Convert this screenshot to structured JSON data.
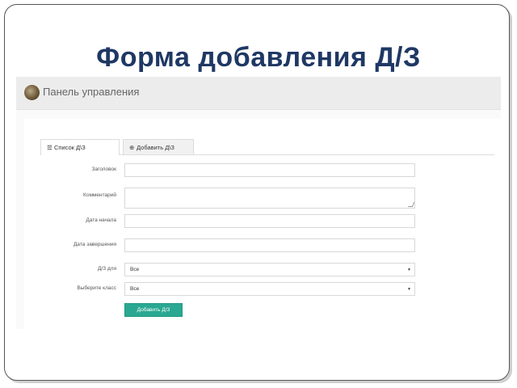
{
  "slide": {
    "title": "Форма добавления Д/З"
  },
  "app": {
    "header_title": "Панель управления"
  },
  "tabs": [
    {
      "label": "Список Д\\З",
      "icon": "list-icon",
      "active": true
    },
    {
      "label": "Добавить Д\\З",
      "icon": "plus-circle-icon",
      "active": false
    }
  ],
  "form": {
    "fields": {
      "title": {
        "label": "Заголовок",
        "value": ""
      },
      "comment": {
        "label": "Комментарий",
        "value": ""
      },
      "start_date": {
        "label": "Дата начала",
        "value": ""
      },
      "end_date": {
        "label": "Дата завершения",
        "value": ""
      },
      "homework_for": {
        "label": "Д/З для",
        "selected": "Все"
      },
      "class": {
        "label": "Выберите класс",
        "selected": "Все"
      }
    },
    "submit_label": "Добавить Д/З"
  },
  "colors": {
    "title": "#1f3864",
    "accent": "#2aa891",
    "header_bg": "#ececec"
  }
}
